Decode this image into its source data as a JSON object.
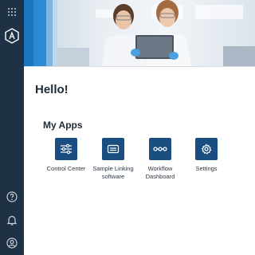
{
  "rail": {
    "icons": [
      "apps-grid-icon",
      "brand-logo-icon",
      "help-icon",
      "notifications-icon",
      "user-account-icon"
    ],
    "background": "#1f3145"
  },
  "page": {
    "greeting": "Hello!",
    "apps_section_title": "My Apps"
  },
  "apps": [
    {
      "label": "Control Center",
      "icon": "sliders-icon"
    },
    {
      "label": "Sample Linking software",
      "icon": "sample-card-icon"
    },
    {
      "label": "Workflow Dashboard",
      "icon": "workflow-icon"
    },
    {
      "label": "Settings",
      "icon": "gear-icon"
    }
  ],
  "colors": {
    "accent": "#1b4e80",
    "rail": "#1f3145",
    "hero_blue": "#1b76c2",
    "hero_light_blue": "#7bb6e3"
  }
}
